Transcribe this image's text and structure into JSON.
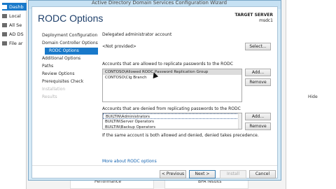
{
  "background": {
    "sidebar_items": [
      {
        "label": "Dashb",
        "selected": true
      },
      {
        "label": "Local",
        "selected": false
      },
      {
        "label": "All Se",
        "selected": false
      },
      {
        "label": "AD DS",
        "selected": false
      },
      {
        "label": "File ar",
        "selected": false
      }
    ],
    "hide_label": "Hide",
    "bottom_tiles": [
      "Performance",
      "BPA results"
    ]
  },
  "window": {
    "title": "Active Directory Domain Services Configuration Wizard"
  },
  "page": {
    "title": "RODC Options",
    "target_server_label": "TARGET SERVER",
    "target_server_value": "msdc1"
  },
  "nav": {
    "items": [
      {
        "label": "Deployment Configuration",
        "state": "normal"
      },
      {
        "label": "Domain Controller Options",
        "state": "normal"
      },
      {
        "label": "RODC Options",
        "state": "active"
      },
      {
        "label": "Additional Options",
        "state": "normal"
      },
      {
        "label": "Paths",
        "state": "normal"
      },
      {
        "label": "Review Options",
        "state": "normal"
      },
      {
        "label": "Prerequisites Check",
        "state": "normal"
      },
      {
        "label": "Installation",
        "state": "disabled"
      },
      {
        "label": "Results",
        "state": "disabled"
      }
    ]
  },
  "content": {
    "delegated_label": "Delegated administrator account",
    "delegated_value": "<Not provided>",
    "select_button": "Select...",
    "allowed_label": "Accounts that are allowed to replicate passwords to the RODC",
    "allowed_accounts": [
      "CONTOSO\\Allowed RODC Password Replication Group",
      "CONTOSO\\Clg Branch"
    ],
    "denied_label": "Accounts that are denied from replicating passwords to the RODC",
    "denied_accounts": [
      "BUILTIN\\Administrators",
      "BUILTIN\\Server Operators",
      "BUILTIN\\Backup Operators"
    ],
    "add_button": "Add...",
    "remove_button": "Remove",
    "precedence_note": "If the same account is both allowed and denied, denied takes precedence.",
    "more_link": "More about RODC options"
  },
  "footer": {
    "previous": "< Previous",
    "next": "Next >",
    "install": "Install",
    "cancel": "Cancel"
  }
}
